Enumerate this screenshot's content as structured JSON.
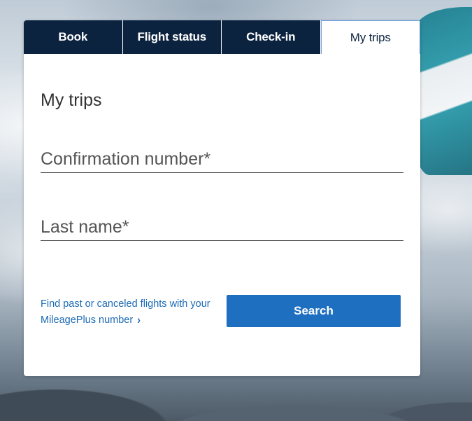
{
  "tabs": [
    {
      "label": "Book",
      "active": false
    },
    {
      "label": "Flight status",
      "active": false
    },
    {
      "label": "Check-in",
      "active": false
    },
    {
      "label": "My trips",
      "active": true
    }
  ],
  "panel": {
    "title": "My trips",
    "confirmation_placeholder": "Confirmation number*",
    "last_name_placeholder": "Last name*",
    "mileage_link_text": "Find past or canceled flights with your MileagePlus number",
    "mileage_link_icon": "chevron-right-icon",
    "search_label": "Search"
  },
  "colors": {
    "tab_background": "#0c2340",
    "active_tab_border": "#6f9be0",
    "link": "#1c6ab4",
    "search_button": "#1f6fc0"
  }
}
